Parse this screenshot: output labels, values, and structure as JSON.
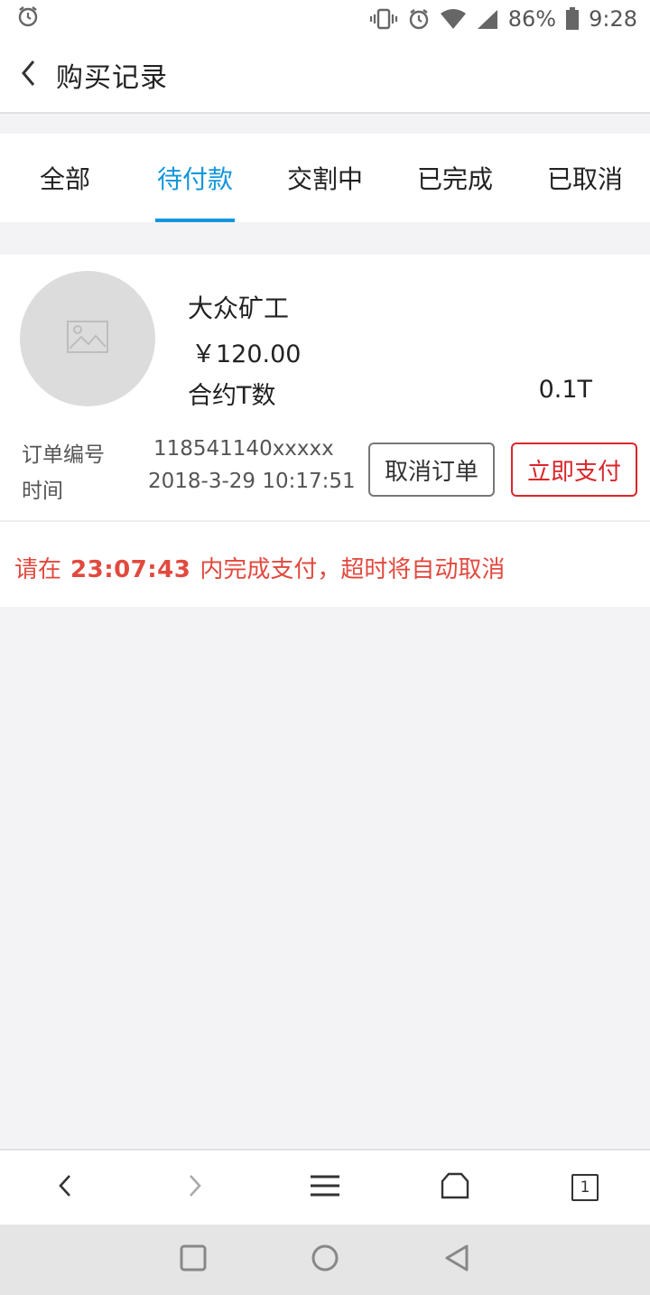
{
  "status_bar": {
    "battery": "86%",
    "time": "9:28"
  },
  "header": {
    "title": "购买记录"
  },
  "tabs": [
    {
      "label": "全部"
    },
    {
      "label": "待付款",
      "active": true
    },
    {
      "label": "交割中"
    },
    {
      "label": "已完成"
    },
    {
      "label": "已取消"
    }
  ],
  "order": {
    "product_name": "大众矿工",
    "price": "￥120.00",
    "spec_label": "合约T数",
    "spec_value": "0.1T",
    "order_no_label": "订单编号",
    "order_no": "118541140xxxxx",
    "time_label": "时间",
    "time": "2018-3-29 10:17:51",
    "cancel_label": "取消订单",
    "pay_label": "立即支付",
    "countdown_prefix": "请在",
    "countdown_time": "23:07:43",
    "countdown_suffix": "内完成支付，超时将自动取消"
  },
  "browser_bar": {
    "tab_count": "1"
  },
  "colors": {
    "accent": "#1296db",
    "danger": "#d9262b",
    "countdown": "#e2493e"
  }
}
